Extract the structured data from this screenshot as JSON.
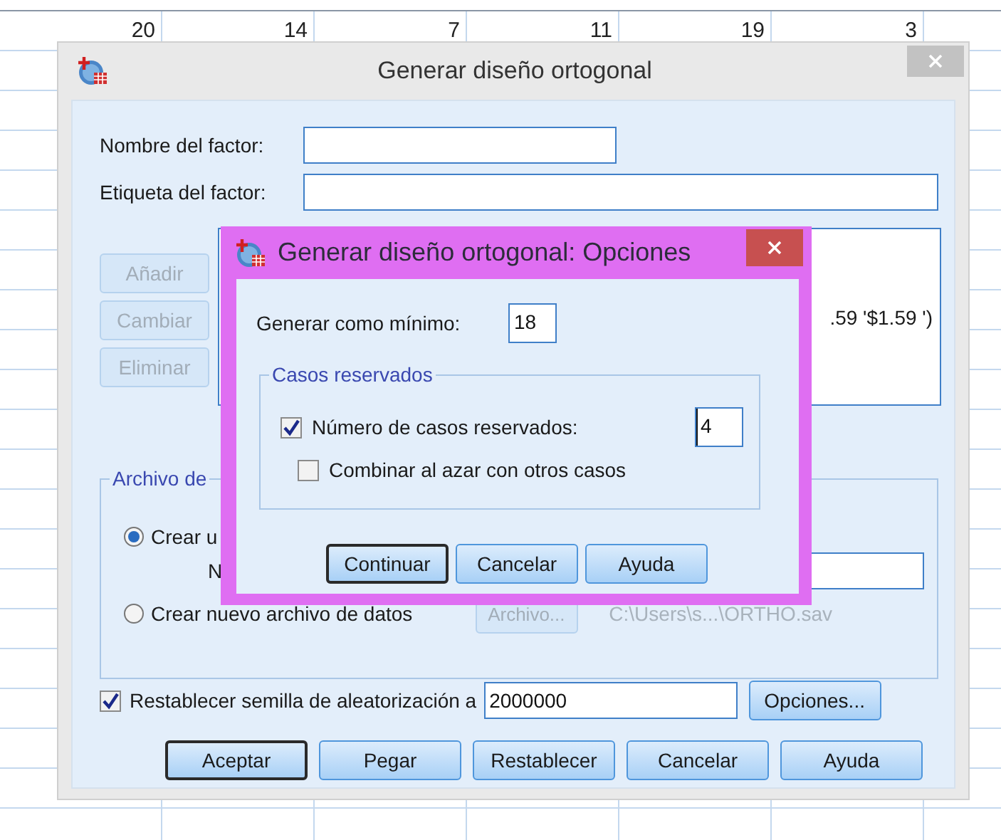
{
  "sheet": {
    "row_values": [
      "20",
      "14",
      "7",
      "11",
      "19",
      "3"
    ]
  },
  "dialog": {
    "title": "Generar diseño ortogonal",
    "fields": [
      {
        "label": "Nombre del factor:"
      },
      {
        "label": "Etiqueta del factor:"
      }
    ],
    "side_buttons": [
      {
        "label": "Añadir",
        "disabled": true
      },
      {
        "label": "Cambiar",
        "disabled": true
      },
      {
        "label": "Eliminar",
        "disabled": true
      }
    ],
    "factor_list": {
      "items": [
        ".59 '$1.59 ')"
      ]
    },
    "data_file_group": {
      "title": "Archivo de",
      "options": [
        {
          "label": "Crear u",
          "selected": true
        },
        {
          "label": "Crear nuevo archivo de datos",
          "selected": false
        }
      ],
      "name_label": "N",
      "file_button": {
        "label": "Archivo...",
        "disabled": true
      },
      "file_path": "C:\\Users\\s...\\ORTHO.sav"
    },
    "reset_seed": {
      "label": "Restablecer semilla de aleatorización a",
      "checked": true,
      "value": "2000000"
    },
    "options_button": {
      "label": "Opciones..."
    },
    "buttons": [
      {
        "label": "Aceptar",
        "default": true
      },
      {
        "label": "Pegar",
        "default": false
      },
      {
        "label": "Restablecer",
        "default": false
      },
      {
        "label": "Cancelar",
        "default": false
      },
      {
        "label": "Ayuda",
        "default": false
      }
    ]
  },
  "options_dialog": {
    "title": "Generar diseño ortogonal: Opciones",
    "min_label": "Generar como mínimo:",
    "min_value": "18",
    "holdout_group": {
      "title": "Casos reservados",
      "options": [
        {
          "label": "Número de casos reservados:",
          "checked": true,
          "value": "4"
        },
        {
          "label": "Combinar al azar con otros casos",
          "checked": false
        }
      ]
    },
    "buttons": [
      {
        "label": "Continuar",
        "default": true
      },
      {
        "label": "Cancelar",
        "default": false
      },
      {
        "label": "Ayuda",
        "default": false
      }
    ]
  }
}
